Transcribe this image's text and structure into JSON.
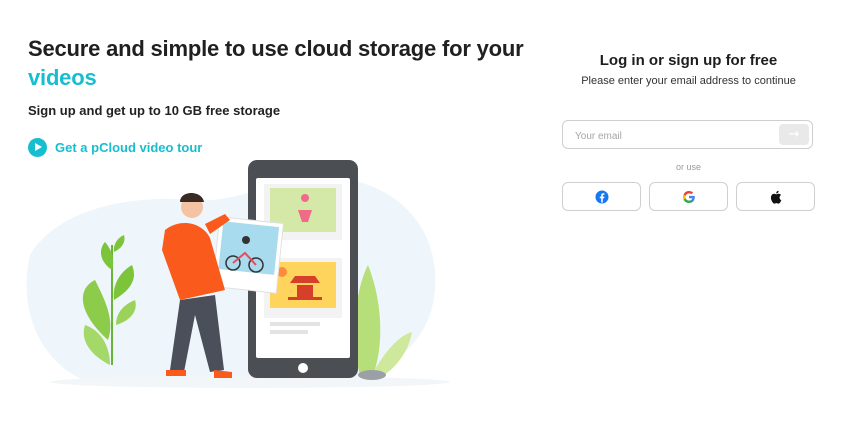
{
  "hero": {
    "title": "Secure and simple to use cloud storage for your",
    "title_accent": "videos",
    "subtitle": "Sign up and get up to 10 GB free storage",
    "tour_link": "Get a pCloud video tour"
  },
  "login": {
    "title": "Log in or sign up for free",
    "subtitle": "Please enter your email address to continue",
    "email_placeholder": "Your email",
    "submit_arrow": "→",
    "or_use": "or use",
    "social": [
      {
        "name": "facebook",
        "icon": "facebook-icon"
      },
      {
        "name": "google",
        "icon": "google-icon"
      },
      {
        "name": "apple",
        "icon": "apple-icon"
      }
    ]
  },
  "colors": {
    "accent": "#17bed0",
    "person_shirt": "#fa5a1c",
    "phone": "#4b4f54",
    "leaf": "#7cc43a"
  }
}
